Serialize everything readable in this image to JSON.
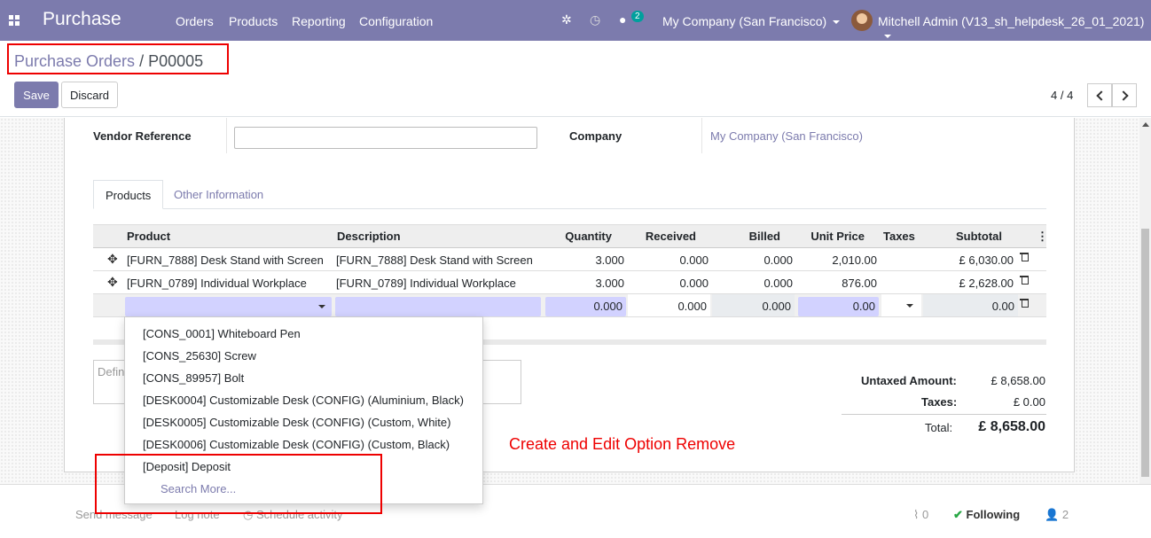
{
  "topbar": {
    "app_name": "Purchase",
    "menus": [
      "Orders",
      "Products",
      "Reporting",
      "Configuration"
    ],
    "chat_badge": "2",
    "company": "My Company (San Francisco)",
    "user": "Mitchell Admin (V13_sh_helpdesk_26_01_2021)"
  },
  "control_panel": {
    "breadcrumb_parent": "Purchase Orders",
    "breadcrumb_sep": "/",
    "breadcrumb_current": "P00005",
    "save_label": "Save",
    "discard_label": "Discard",
    "pager": "4 / 4"
  },
  "form": {
    "vendor_reference_label": "Vendor Reference",
    "vendor_reference_value": "",
    "company_label": "Company",
    "company_value": "My Company (San Francisco)"
  },
  "tabs": [
    "Products",
    "Other Information"
  ],
  "lines": {
    "headers": [
      "Product",
      "Description",
      "Quantity",
      "Received",
      "Billed",
      "Unit Price",
      "Taxes",
      "Subtotal"
    ],
    "rows": [
      {
        "product": "[FURN_7888] Desk Stand with Screen",
        "description": "[FURN_7888] Desk Stand with Screen",
        "quantity": "3.000",
        "received": "0.000",
        "billed": "0.000",
        "unit_price": "2,010.00",
        "taxes": "",
        "subtotal": "£ 6,030.00"
      },
      {
        "product": "[FURN_0789] Individual Workplace",
        "description": "[FURN_0789] Individual Workplace",
        "quantity": "3.000",
        "received": "0.000",
        "billed": "0.000",
        "unit_price": "876.00",
        "taxes": "",
        "subtotal": "£ 2,628.00"
      }
    ],
    "edit_row": {
      "quantity": "0.000",
      "received": "0.000",
      "billed": "0.000",
      "unit_price": "0.00",
      "subtotal": "0.00"
    }
  },
  "notes_placeholder": "Defin",
  "totals": {
    "untaxed_label": "Untaxed Amount:",
    "untaxed_value": "£ 8,658.00",
    "taxes_label": "Taxes:",
    "taxes_value": "£ 0.00",
    "total_label": "Total:",
    "total_value": "£ 8,658.00"
  },
  "dropdown": {
    "items": [
      "[CONS_0001] Whiteboard Pen",
      "[CONS_25630] Screw",
      "[CONS_89957] Bolt",
      "[DESK0004] Customizable Desk (CONFIG) (Aluminium, Black)",
      "[DESK0005] Customizable Desk (CONFIG) (Custom, White)",
      "[DESK0006] Customizable Desk (CONFIG) (Custom, Black)",
      "[Deposit] Deposit"
    ],
    "search_more": "Search More..."
  },
  "annotation": "Create and Edit Option Remove",
  "chatter": {
    "send_message": "Send message",
    "log_note": "Log note",
    "schedule_activity": "Schedule activity",
    "attachments": "0",
    "following": "Following",
    "followers": "2"
  },
  "colors": {
    "brand": "#7c7bad",
    "annotation": "#e00000",
    "badge": "#00a09d",
    "following": "#28a745"
  }
}
